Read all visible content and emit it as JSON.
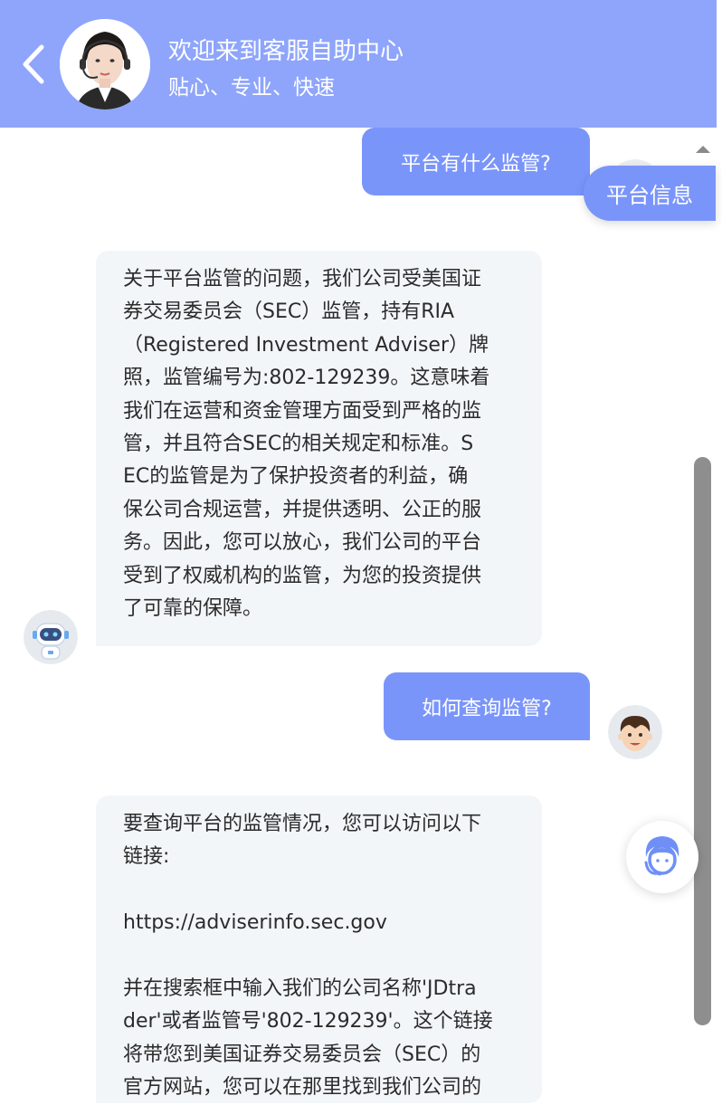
{
  "header": {
    "title": "欢迎来到客服自助中心",
    "subtitle": "贴心、专业、快速",
    "back_icon": "chevron-left-icon",
    "avatar": "agent-avatar"
  },
  "floating_button": {
    "label": "平台信息"
  },
  "messages": [
    {
      "role": "user",
      "text": "平台有什么监管?"
    },
    {
      "role": "bot",
      "lines": [
        "关于平台监管的问题，我们公司受美国证",
        "券交易委员会（SEC）监管，持有RIA",
        "（Registered Investment Adviser）牌",
        "照，监管编号为:802-129239。这意味着",
        "我们在运营和资金管理方面受到严格的监",
        "管，并且符合SEC的相关规定和标准。S",
        "EC的监管是为了保护投资者的利益，确",
        "保公司合规运营，并提供透明、公正的服",
        "务。因此，您可以放心，我们公司的平台",
        "受到了权威机构的监管，为您的投资提供",
        "了可靠的保障。"
      ]
    },
    {
      "role": "user",
      "text": "如何查询监管?"
    },
    {
      "role": "bot",
      "paragraphs": [
        [
          "要查询平台的监管情况，您可以访问以下",
          "链接:"
        ],
        [
          "https://adviserinfo.sec.gov"
        ],
        [
          "并在搜索框中输入我们的公司名称'JDtra",
          "der'或者监管号'802-129239'。这个链接",
          "将带您到美国证券交易委员会（SEC）的",
          "官方网站，您可以在那里找到我们公司的"
        ]
      ]
    }
  ],
  "colors": {
    "header": "#8ea5fb",
    "user_bubble": "#7a95fa",
    "bot_bubble": "#f3f6f9"
  }
}
